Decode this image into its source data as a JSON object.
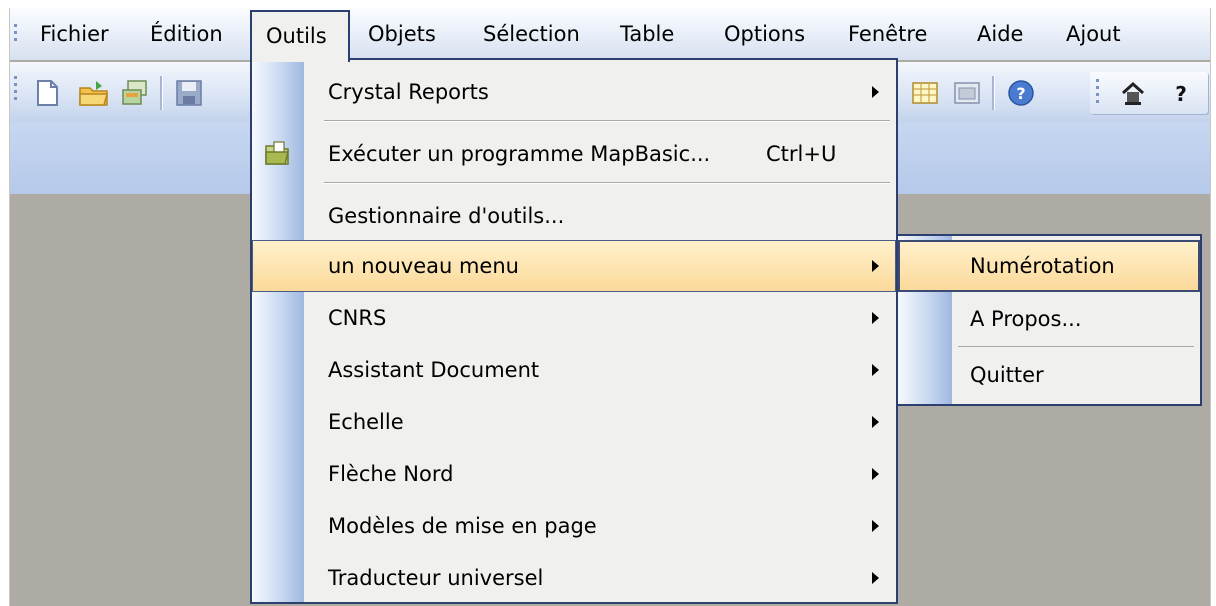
{
  "menubar": {
    "items": [
      {
        "label": "Fichier"
      },
      {
        "label": "Édition"
      },
      {
        "label": "Outils"
      },
      {
        "label": "Objets"
      },
      {
        "label": "Sélection"
      },
      {
        "label": "Table"
      },
      {
        "label": "Options"
      },
      {
        "label": "Fenêtre"
      },
      {
        "label": "Aide"
      },
      {
        "label": "Ajout"
      }
    ],
    "active": "Outils"
  },
  "toolbar": {
    "icons": [
      "new-document-icon",
      "open-folder-icon",
      "open-workspace-icon",
      "save-icon",
      "grid-browser-icon",
      "layout-window-icon",
      "help-icon",
      "home-icon",
      "question-mark-icon"
    ]
  },
  "outils_menu": {
    "items": [
      {
        "label": "Crystal Reports",
        "submenu": true
      },
      {
        "label": "Exécuter un programme MapBasic...",
        "shortcut": "Ctrl+U",
        "icon": "run-mapbasic-icon"
      },
      {
        "label": "Gestionnaire d'outils..."
      },
      {
        "label": "un nouveau menu",
        "submenu": true,
        "highlighted": true
      },
      {
        "label": "CNRS",
        "submenu": true
      },
      {
        "label": "Assistant Document",
        "submenu": true
      },
      {
        "label": "Echelle",
        "submenu": true
      },
      {
        "label": "Flèche Nord",
        "submenu": true
      },
      {
        "label": "Modèles de mise en page",
        "submenu": true
      },
      {
        "label": "Traducteur universel",
        "submenu": true
      }
    ]
  },
  "submenu": {
    "items": [
      {
        "label": "Numérotation",
        "highlighted": true
      },
      {
        "label": "A Propos..."
      },
      {
        "label": "Quitter"
      }
    ]
  },
  "colors": {
    "highlight": "#fbd99a",
    "menu_border": "#2d3f6e",
    "menu_bg": "#f0f0ee",
    "workspace": "#adaba3"
  }
}
